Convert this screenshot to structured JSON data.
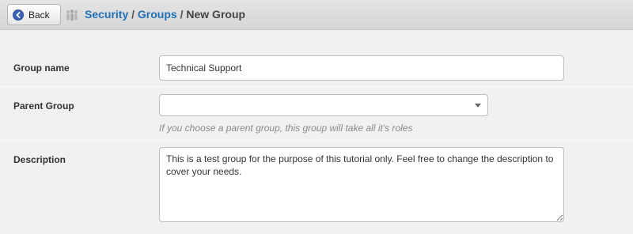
{
  "header": {
    "back_label": "Back",
    "breadcrumb": {
      "security": "Security",
      "sep1": " / ",
      "groups": "Groups",
      "sep2": " / ",
      "current": "New Group"
    }
  },
  "form": {
    "group_name": {
      "label": "Group name",
      "value": "Technical Support"
    },
    "parent_group": {
      "label": "Parent Group",
      "value": "",
      "hint": "If you choose a parent group, this group will take all it's roles"
    },
    "description": {
      "label": "Description",
      "value": "This is a test group for the purpose of this tutorial only. Feel free to change the description to cover your needs."
    }
  },
  "colors": {
    "link": "#1f6fb8",
    "back_icon": "#3a63b8",
    "background": "#f1f1f1"
  }
}
